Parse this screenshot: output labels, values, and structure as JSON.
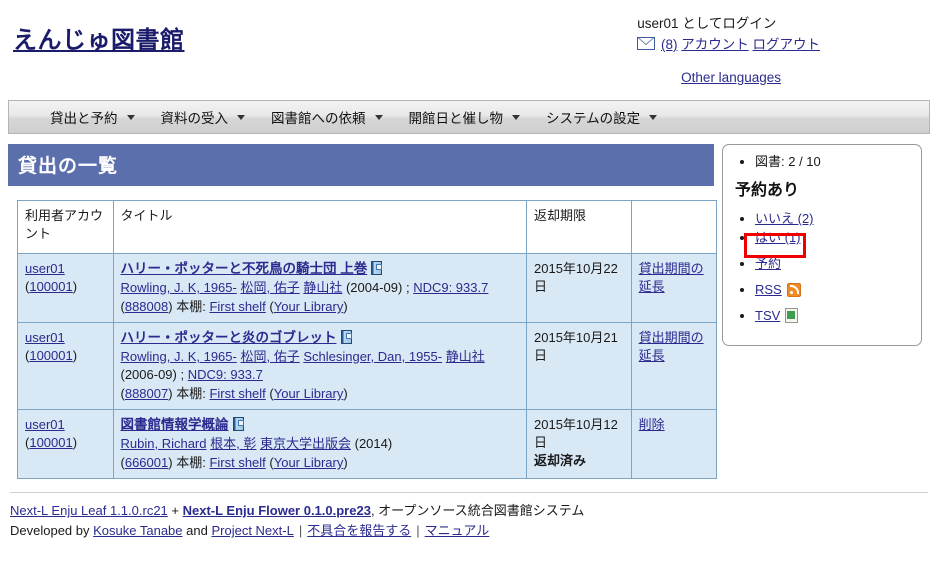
{
  "header": {
    "site_title": "えんじゅ図書館",
    "logged_in_text": "user01 としてログイン",
    "mail_icon": "envelope-icon",
    "message_count": "(8)",
    "account_link": "アカウント",
    "logout_link": "ログアウト",
    "other_languages": "Other languages"
  },
  "nav": {
    "items": [
      {
        "label": "貸出と予約"
      },
      {
        "label": "資料の受入"
      },
      {
        "label": "図書館への依頼"
      },
      {
        "label": "開館日と催し物"
      },
      {
        "label": "システムの設定"
      }
    ]
  },
  "main": {
    "page_title": "貸出の一覧",
    "table": {
      "headers": [
        "利用者アカウント",
        "タイトル",
        "返却期限",
        ""
      ],
      "rows": [
        {
          "user": "user01",
          "user_id": "(100001)",
          "title": "ハリー・ポッターと不死鳥の騎士団 上巻",
          "book_icon": "book-icon",
          "author1": "Rowling, J. K, 1965-",
          "author2": "松岡, 佑子",
          "publisher": "静山社",
          "pubdate": "(2004-09)",
          "separator": " ; ",
          "classification": "NDC9: 933.7",
          "item_id": "(888008)",
          "shelf_label": "本棚:",
          "shelf": "First shelf",
          "library_open": "(",
          "library": "Your Library",
          "library_close": ")",
          "due_date": "2015年10月22日",
          "status": "",
          "action": "貸出期間の延長"
        },
        {
          "user": "user01",
          "user_id": "(100001)",
          "title": "ハリー・ポッターと炎のゴブレット",
          "book_icon": "book-icon",
          "author1": "Rowling, J. K, 1965-",
          "author2": "松岡, 佑子",
          "author3": "Schlesinger, Dan, 1955-",
          "publisher": "静山社",
          "pubdate": "(2006-09)",
          "separator": " ; ",
          "classification": "NDC9: 933.7",
          "item_id": "(888007)",
          "shelf_label": "本棚:",
          "shelf": "First shelf",
          "library_open": "(",
          "library": "Your Library",
          "library_close": ")",
          "due_date": "2015年10月21日",
          "status": "",
          "action": "貸出期間の延長"
        },
        {
          "user": "user01",
          "user_id": "(100001)",
          "title": "図書館情報学概論",
          "book_icon": "book-icon",
          "author1": "Rubin, Richard",
          "author2": "根本, 彰",
          "publisher": "東京大学出版会",
          "pubdate": "(2014)",
          "separator": "",
          "classification": "",
          "item_id": "(666001)",
          "shelf_label": "本棚:",
          "shelf": "First shelf",
          "library_open": "(",
          "library": "Your Library",
          "library_close": ")",
          "due_date": "2015年10月12日",
          "status": "返却済み",
          "action": "削除"
        }
      ]
    }
  },
  "sidebar": {
    "count_label": "図書: 2 / 10",
    "heading": "予約あり",
    "items": [
      {
        "label": "いいえ (2)",
        "icon": ""
      },
      {
        "label": "はい (1)",
        "icon": ""
      },
      {
        "label": "予約",
        "icon": ""
      },
      {
        "label": "RSS",
        "icon": "rss-icon"
      },
      {
        "label": "TSV",
        "icon": "tsv-icon"
      }
    ],
    "highlight_target": "はい (1)"
  },
  "footer": {
    "app1": "Next-L Enju Leaf 1.1.0.rc21",
    "plus": " + ",
    "app2": "Next-L Enju Flower 0.1.0.pre23",
    "tagline": ", オープンソース統合図書館システム",
    "developed_by": "Developed by",
    "dev1": "Kosuke Tanabe",
    "and": "and",
    "dev2": "Project Next-L",
    "report": "不具合を報告する",
    "manual": "マニュアル"
  },
  "colors": {
    "title_bar": "#5b6fad",
    "row_background": "#d8e8f5",
    "link": "#2b2b8f",
    "highlight": "#ee0000",
    "rss": "#f08a24",
    "tsv": "#3f9e4d"
  }
}
